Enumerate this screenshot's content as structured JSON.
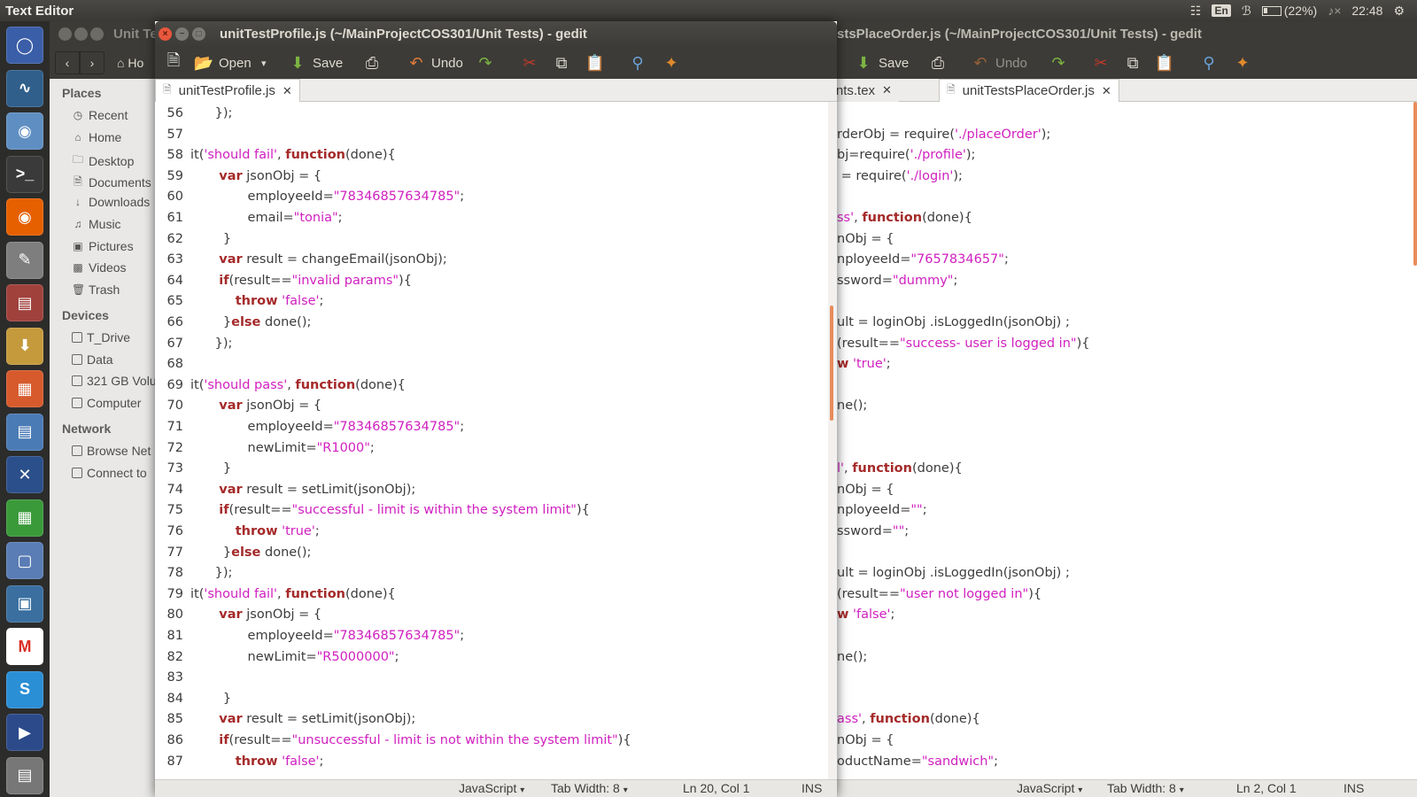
{
  "top_panel": {
    "app_title": "Text Editor",
    "language": "En",
    "battery": "(22%)",
    "clock": "22:48"
  },
  "file_manager": {
    "title": "Unit Te",
    "home_crumb": "Ho",
    "places_header": "Places",
    "places": [
      "Recent",
      "Home",
      "Desktop",
      "Documents",
      "Downloads",
      "Music",
      "Pictures",
      "Videos",
      "Trash"
    ],
    "devices_header": "Devices",
    "devices": [
      "T_Drive",
      "Data",
      "321 GB Volu",
      "Computer"
    ],
    "network_header": "Network",
    "network": [
      "Browse Net",
      "Connect to"
    ]
  },
  "main_window": {
    "title": "unitTestProfile.js (~/MainProjectCOS301/Unit Tests) - gedit",
    "toolbar": {
      "open": "Open",
      "save": "Save",
      "undo": "Undo"
    },
    "tab": "unitTestProfile.js",
    "tab_close": "✕",
    "status": {
      "language": "JavaScript",
      "tab_width": "Tab Width: 8",
      "position": "Ln 20, Col 1",
      "mode": "INS"
    },
    "lines": [
      {
        "n": "56",
        "parts": [
          [
            "",
            "      });"
          ]
        ]
      },
      {
        "n": "57",
        "parts": [
          [
            "",
            ""
          ]
        ]
      },
      {
        "n": "58",
        "parts": [
          [
            "",
            "it("
          ],
          [
            "str",
            "'should fail'"
          ],
          [
            "",
            ", "
          ],
          [
            "kw",
            "function"
          ],
          [
            "",
            "(done){"
          ]
        ]
      },
      {
        "n": "59",
        "parts": [
          [
            "",
            "       "
          ],
          [
            "kw",
            "var"
          ],
          [
            "",
            " jsonObj = {"
          ]
        ]
      },
      {
        "n": "60",
        "parts": [
          [
            "",
            "              employeeId="
          ],
          [
            "str",
            "\"78346857634785\""
          ],
          [
            "",
            ";"
          ]
        ]
      },
      {
        "n": "61",
        "parts": [
          [
            "",
            "              email="
          ],
          [
            "str",
            "\"tonia\""
          ],
          [
            "",
            ";"
          ]
        ]
      },
      {
        "n": "62",
        "parts": [
          [
            "",
            "        }"
          ]
        ]
      },
      {
        "n": "63",
        "parts": [
          [
            "",
            "       "
          ],
          [
            "kw",
            "var"
          ],
          [
            "",
            " result = changeEmail(jsonObj);"
          ]
        ]
      },
      {
        "n": "64",
        "parts": [
          [
            "",
            "       "
          ],
          [
            "kw",
            "if"
          ],
          [
            "",
            "(result=="
          ],
          [
            "str",
            "\"invalid params\""
          ],
          [
            "",
            "){"
          ]
        ]
      },
      {
        "n": "65",
        "parts": [
          [
            "",
            "           "
          ],
          [
            "kw",
            "throw"
          ],
          [
            "",
            " "
          ],
          [
            "str",
            "'false'"
          ],
          [
            "",
            ";"
          ]
        ]
      },
      {
        "n": "66",
        "parts": [
          [
            "",
            "        }"
          ],
          [
            "kw",
            "else"
          ],
          [
            "",
            " done();"
          ]
        ]
      },
      {
        "n": "67",
        "parts": [
          [
            "",
            "      });"
          ]
        ]
      },
      {
        "n": "68",
        "parts": [
          [
            "",
            ""
          ]
        ]
      },
      {
        "n": "69",
        "parts": [
          [
            "",
            "it("
          ],
          [
            "str",
            "'should pass'"
          ],
          [
            "",
            ", "
          ],
          [
            "kw",
            "function"
          ],
          [
            "",
            "(done){"
          ]
        ]
      },
      {
        "n": "70",
        "parts": [
          [
            "",
            "       "
          ],
          [
            "kw",
            "var"
          ],
          [
            "",
            " jsonObj = {"
          ]
        ]
      },
      {
        "n": "71",
        "parts": [
          [
            "",
            "              employeeId="
          ],
          [
            "str",
            "\"78346857634785\""
          ],
          [
            "",
            ";"
          ]
        ]
      },
      {
        "n": "72",
        "parts": [
          [
            "",
            "              newLimit="
          ],
          [
            "str",
            "\"R1000\""
          ],
          [
            "",
            ";"
          ]
        ]
      },
      {
        "n": "73",
        "parts": [
          [
            "",
            "        }"
          ]
        ]
      },
      {
        "n": "74",
        "parts": [
          [
            "",
            "       "
          ],
          [
            "kw",
            "var"
          ],
          [
            "",
            " result = setLimit(jsonObj);"
          ]
        ]
      },
      {
        "n": "75",
        "parts": [
          [
            "",
            "       "
          ],
          [
            "kw",
            "if"
          ],
          [
            "",
            "(result=="
          ],
          [
            "str",
            "\"successful - limit is within the system limit\""
          ],
          [
            "",
            "){"
          ]
        ]
      },
      {
        "n": "76",
        "parts": [
          [
            "",
            "           "
          ],
          [
            "kw",
            "throw"
          ],
          [
            "",
            " "
          ],
          [
            "str",
            "'true'"
          ],
          [
            "",
            ";"
          ]
        ]
      },
      {
        "n": "77",
        "parts": [
          [
            "",
            "        }"
          ],
          [
            "kw",
            "else"
          ],
          [
            "",
            " done();"
          ]
        ]
      },
      {
        "n": "78",
        "parts": [
          [
            "",
            "      });"
          ]
        ]
      },
      {
        "n": "79",
        "parts": [
          [
            "",
            "it("
          ],
          [
            "str",
            "'should fail'"
          ],
          [
            "",
            ", "
          ],
          [
            "kw",
            "function"
          ],
          [
            "",
            "(done){"
          ]
        ]
      },
      {
        "n": "80",
        "parts": [
          [
            "",
            "       "
          ],
          [
            "kw",
            "var"
          ],
          [
            "",
            " jsonObj = {"
          ]
        ]
      },
      {
        "n": "81",
        "parts": [
          [
            "",
            "              employeeId="
          ],
          [
            "str",
            "\"78346857634785\""
          ],
          [
            "",
            ";"
          ]
        ]
      },
      {
        "n": "82",
        "parts": [
          [
            "",
            "              newLimit="
          ],
          [
            "str",
            "\"R5000000\""
          ],
          [
            "",
            ";"
          ]
        ]
      },
      {
        "n": "83",
        "parts": [
          [
            "",
            ""
          ]
        ]
      },
      {
        "n": "84",
        "parts": [
          [
            "",
            "        }"
          ]
        ]
      },
      {
        "n": "85",
        "parts": [
          [
            "",
            "       "
          ],
          [
            "kw",
            "var"
          ],
          [
            "",
            " result = setLimit(jsonObj);"
          ]
        ]
      },
      {
        "n": "86",
        "parts": [
          [
            "",
            "       "
          ],
          [
            "kw",
            "if"
          ],
          [
            "",
            "(result=="
          ],
          [
            "str",
            "\"unsuccessful - limit is not within the system limit\""
          ],
          [
            "",
            "){"
          ]
        ]
      },
      {
        "n": "87",
        "parts": [
          [
            "",
            "           "
          ],
          [
            "kw",
            "throw"
          ],
          [
            "",
            " "
          ],
          [
            "str",
            "'false'"
          ],
          [
            "",
            ";"
          ]
        ]
      }
    ]
  },
  "right_window": {
    "title": "stsPlaceOrder.js (~/MainProjectCOS301/Unit Tests) - gedit",
    "toolbar": {
      "save": "Save",
      "undo": "Undo"
    },
    "tab_prev": "uirements.tex",
    "tab_active": "unitTestsPlaceOrder.js",
    "tab_close": "✕",
    "status": {
      "language": "JavaScript",
      "tab_width": "Tab Width: 8",
      "position": "Ln 2, Col 1",
      "mode": "INS"
    },
    "lines": [
      {
        "parts": [
          [
            "",
            ""
          ]
        ]
      },
      {
        "parts": [
          [
            "",
            "rderObj = require("
          ],
          [
            "str",
            "'./placeOrder'"
          ],
          [
            "",
            ");"
          ]
        ]
      },
      {
        "parts": [
          [
            "",
            "bj=require("
          ],
          [
            "str",
            "'./profile'"
          ],
          [
            "",
            ");"
          ]
        ]
      },
      {
        "parts": [
          [
            "",
            " = require("
          ],
          [
            "str",
            "'./login'"
          ],
          [
            "",
            ");"
          ]
        ]
      },
      {
        "parts": [
          [
            "",
            ""
          ]
        ]
      },
      {
        "parts": [
          [
            "str",
            "ss'"
          ],
          [
            "",
            ", "
          ],
          [
            "kw",
            "function"
          ],
          [
            "",
            "(done){"
          ]
        ]
      },
      {
        "parts": [
          [
            "",
            "nObj = {"
          ]
        ]
      },
      {
        "parts": [
          [
            "",
            "nployeeId="
          ],
          [
            "str",
            "\"7657834657\""
          ],
          [
            "",
            ";"
          ]
        ]
      },
      {
        "parts": [
          [
            "",
            "ssword="
          ],
          [
            "str",
            "\"dummy\""
          ],
          [
            "",
            ";"
          ]
        ]
      },
      {
        "parts": [
          [
            "",
            ""
          ]
        ]
      },
      {
        "parts": [
          [
            "",
            "ult = loginObj .isLoggedIn(jsonObj) ;"
          ]
        ]
      },
      {
        "parts": [
          [
            "",
            "(result=="
          ],
          [
            "str",
            "\"success- user is logged in\""
          ],
          [
            "",
            "){"
          ]
        ]
      },
      {
        "parts": [
          [
            "kw",
            "w"
          ],
          [
            "",
            " "
          ],
          [
            "str",
            "'true'"
          ],
          [
            "",
            ";"
          ]
        ]
      },
      {
        "parts": [
          [
            "",
            ""
          ]
        ]
      },
      {
        "parts": [
          [
            "",
            "ne();"
          ]
        ]
      },
      {
        "parts": [
          [
            "",
            ""
          ]
        ]
      },
      {
        "parts": [
          [
            "",
            ""
          ]
        ]
      },
      {
        "parts": [
          [
            "str",
            "l'"
          ],
          [
            "",
            ", "
          ],
          [
            "kw",
            "function"
          ],
          [
            "",
            "(done){"
          ]
        ]
      },
      {
        "parts": [
          [
            "",
            "nObj = {"
          ]
        ]
      },
      {
        "parts": [
          [
            "",
            "nployeeId="
          ],
          [
            "str",
            "\"\""
          ],
          [
            "",
            ";"
          ]
        ]
      },
      {
        "parts": [
          [
            "",
            "ssword="
          ],
          [
            "str",
            "\"\""
          ],
          [
            "",
            ";"
          ]
        ]
      },
      {
        "parts": [
          [
            "",
            ""
          ]
        ]
      },
      {
        "parts": [
          [
            "",
            "ult = loginObj .isLoggedIn(jsonObj) ;"
          ]
        ]
      },
      {
        "parts": [
          [
            "",
            "(result=="
          ],
          [
            "str",
            "\"user not logged in\""
          ],
          [
            "",
            "){"
          ]
        ]
      },
      {
        "parts": [
          [
            "kw",
            "w"
          ],
          [
            "",
            " "
          ],
          [
            "str",
            "'false'"
          ],
          [
            "",
            ";"
          ]
        ]
      },
      {
        "parts": [
          [
            "",
            ""
          ]
        ]
      },
      {
        "parts": [
          [
            "",
            "ne();"
          ]
        ]
      },
      {
        "parts": [
          [
            "",
            ""
          ]
        ]
      },
      {
        "parts": [
          [
            "",
            ""
          ]
        ]
      },
      {
        "parts": [
          [
            "str",
            "ass'"
          ],
          [
            "",
            ", "
          ],
          [
            "kw",
            "function"
          ],
          [
            "",
            "(done){"
          ]
        ]
      },
      {
        "parts": [
          [
            "",
            "nObj = {"
          ]
        ]
      },
      {
        "parts": [
          [
            "",
            "oductName="
          ],
          [
            "str",
            "\"sandwich\""
          ],
          [
            "",
            ";"
          ]
        ]
      }
    ]
  },
  "launcher": {
    "icons": [
      "ubuntu-dash-icon",
      "system-monitor-icon",
      "chromium-icon",
      "terminal-icon",
      "firefox-icon",
      "text-editor-icon",
      "files-icon",
      "downloads-icon",
      "presentation-icon",
      "image-viewer-icon",
      "xmind-icon",
      "spreadsheet-icon",
      "virtualbox-icon",
      "system-icon",
      "gmail-icon",
      "skype-icon",
      "kodi-icon",
      "trash-icon"
    ],
    "colors": [
      "#3b5ea8",
      "#2f5f8a",
      "#5f8fc2",
      "#3a3a3a",
      "#e66000",
      "#7e7e7e",
      "#a0413c",
      "#c49a3c",
      "#d65a2c",
      "#4b7bb5",
      "#2a4f8a",
      "#3a9a3a",
      "#5a7db5",
      "#3a6fa0",
      "#ffffff",
      "#2b8fd5",
      "#2c4a8a",
      "#777777"
    ]
  }
}
